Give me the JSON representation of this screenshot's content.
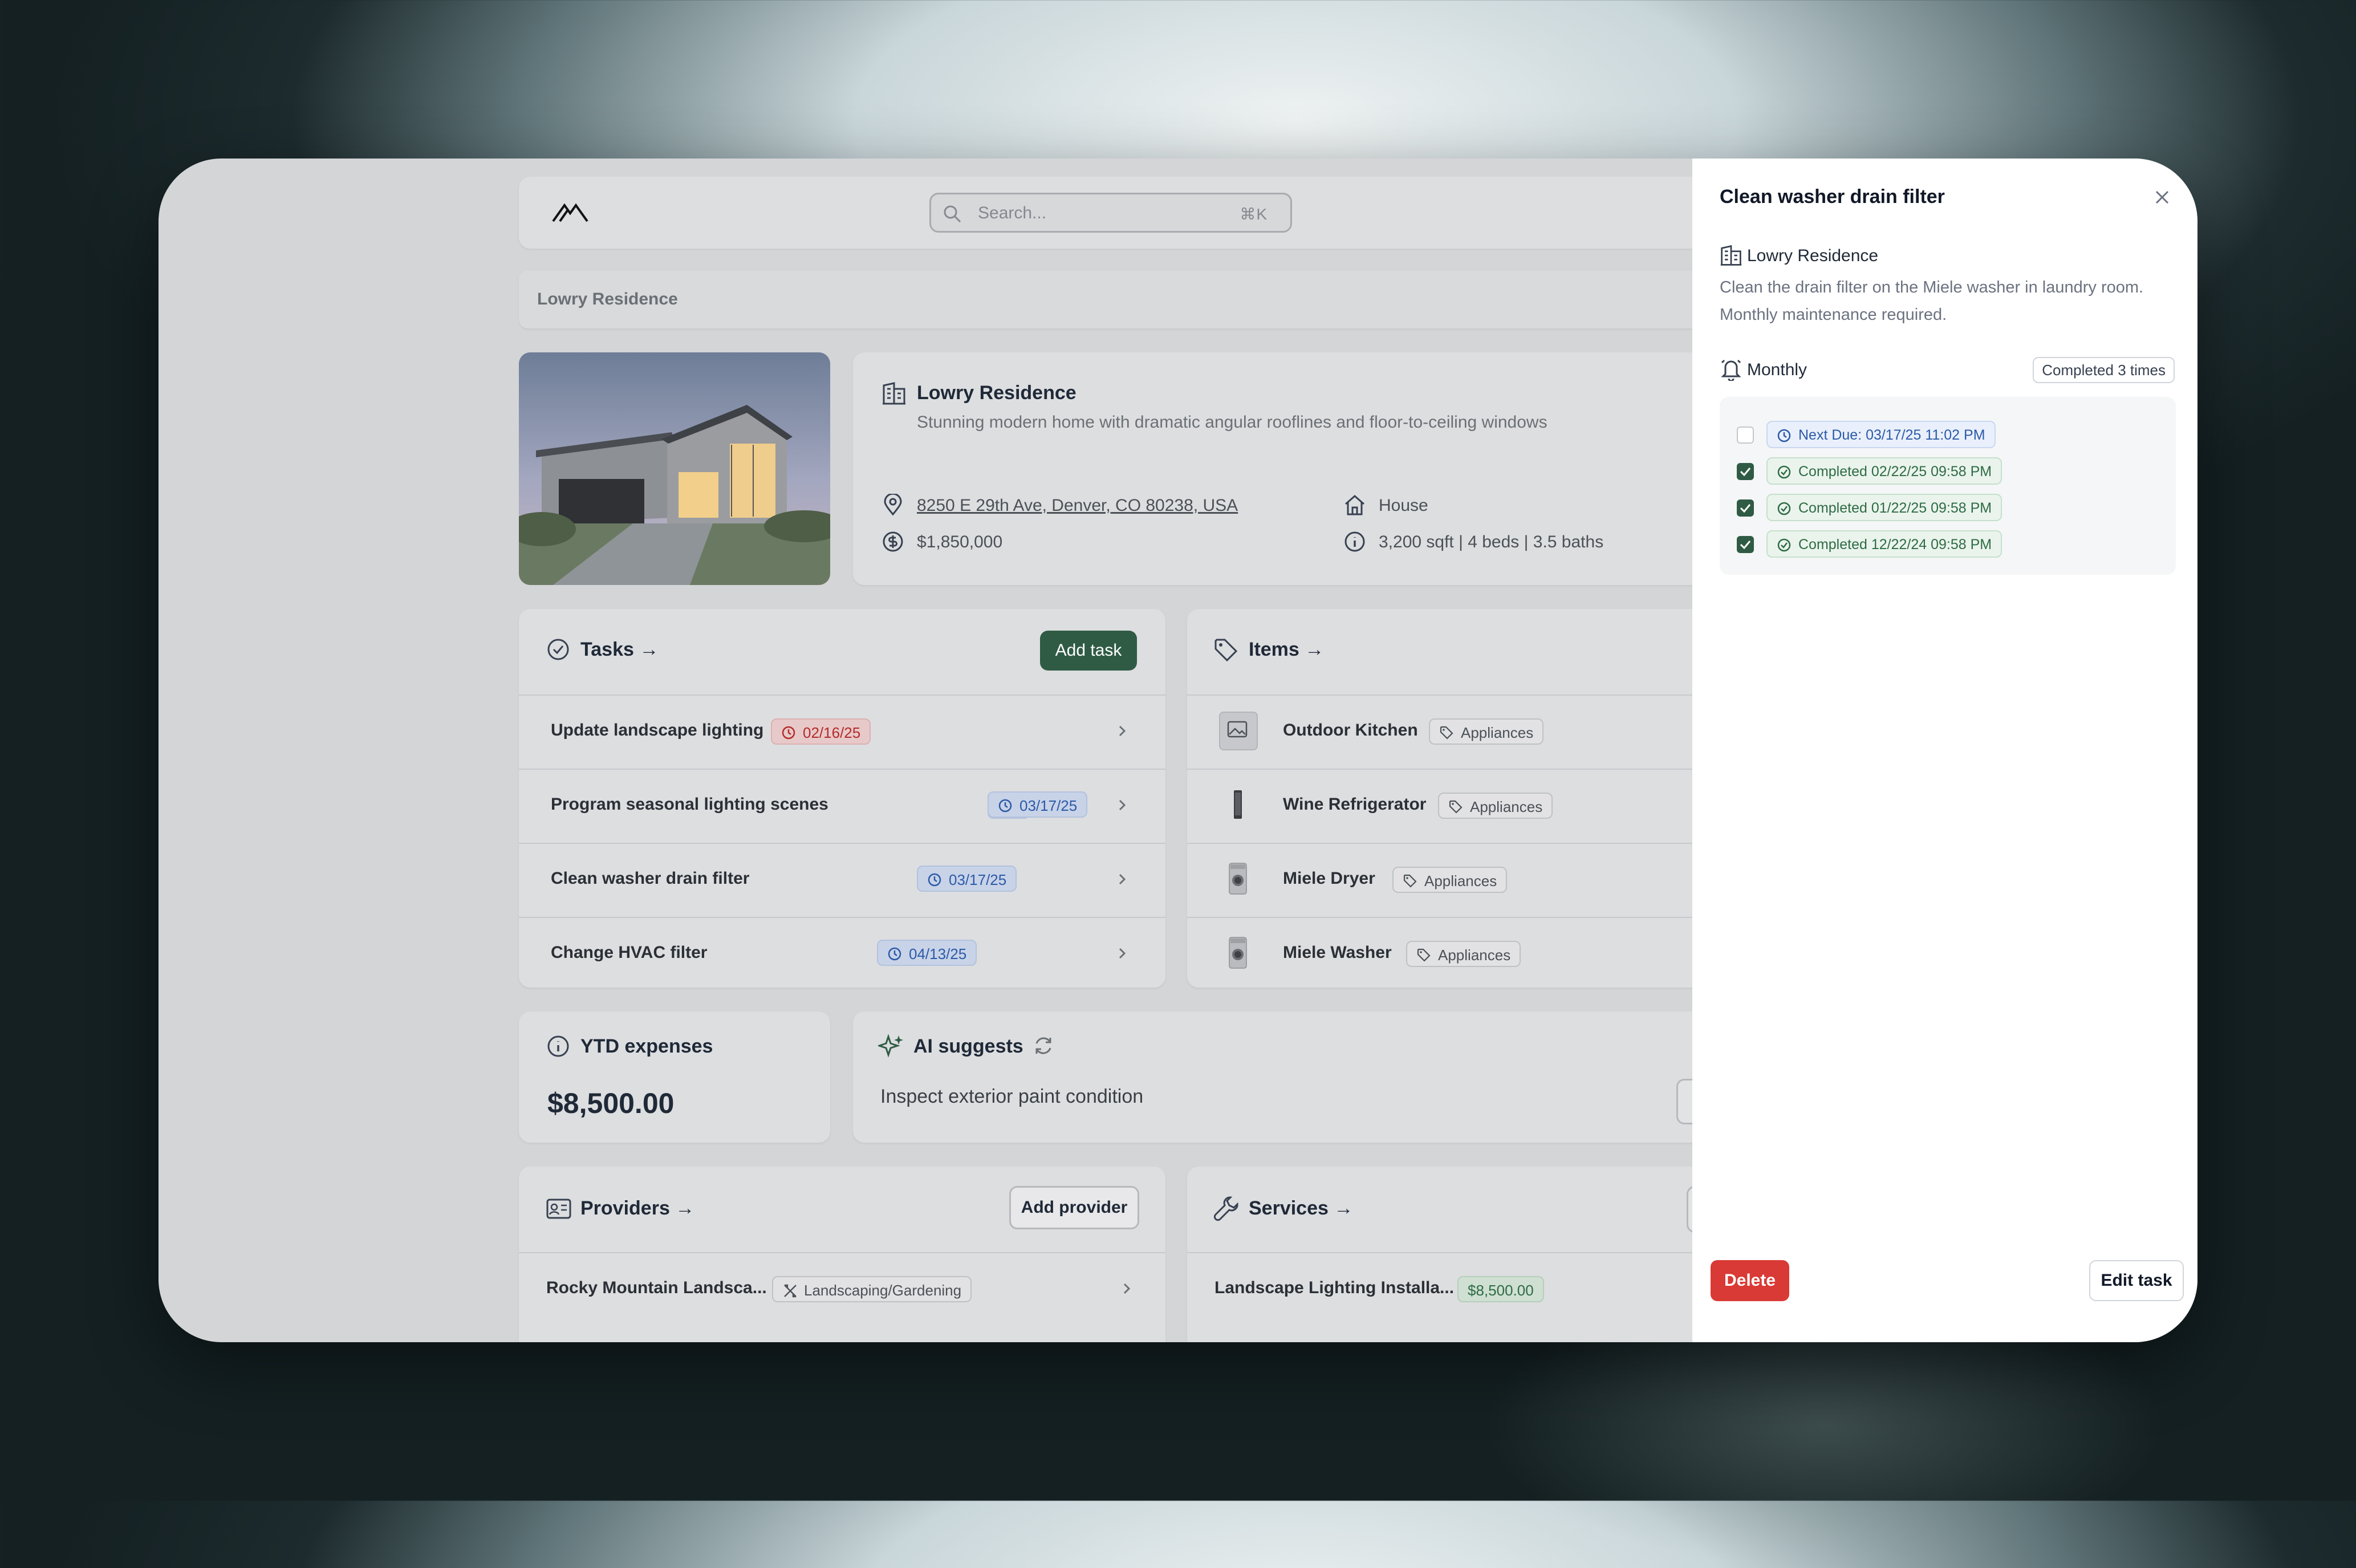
{
  "search": {
    "placeholder": "Search...",
    "shortcut": "⌘K"
  },
  "breadcrumb": {
    "current": "Lowry Residence"
  },
  "property": {
    "name": "Lowry Residence",
    "description": "Stunning modern home with dramatic angular rooflines and floor-to-ceiling windows",
    "address": "8250 E 29th Ave, Denver, CO 80238, USA",
    "price": "$1,850,000",
    "type": "House",
    "details": "3,200 sqft | 4 beds | 3.5 baths"
  },
  "tasks": {
    "title": "Tasks →",
    "add_label": "Add task",
    "rows": [
      {
        "name": "Update landscape lighting",
        "date": "02/16/25",
        "status": "overdue"
      },
      {
        "name": "Program seasonal lighting scenes",
        "date": "03/17/25",
        "status": "upcoming"
      },
      {
        "name": "Clean washer drain filter",
        "date": "03/17/25",
        "status": "upcoming"
      },
      {
        "name": "Change HVAC filter",
        "date": "04/13/25",
        "status": "upcoming"
      }
    ]
  },
  "items": {
    "title": "Items →",
    "rows": [
      {
        "name": "Outdoor Kitchen",
        "tag": "Appliances",
        "thumb": "image-placeholder-icon"
      },
      {
        "name": "Wine Refrigerator",
        "tag": "Appliances",
        "thumb": "wine-fridge"
      },
      {
        "name": "Miele Dryer",
        "tag": "Appliances",
        "thumb": "dryer"
      },
      {
        "name": "Miele Washer",
        "tag": "Appliances",
        "thumb": "washer"
      }
    ]
  },
  "ytd": {
    "title": "YTD expenses",
    "amount": "$8,500.00"
  },
  "ai": {
    "title": "AI suggests",
    "suggestion": "Inspect exterior paint condition"
  },
  "providers": {
    "title": "Providers →",
    "add_label": "Add provider",
    "rows": [
      {
        "name": "Rocky Mountain Landsca...",
        "tag": "Landscaping/Gardening"
      }
    ]
  },
  "services": {
    "title": "Services →",
    "rows": [
      {
        "name": "Landscape Lighting Installa...",
        "amount": "$8,500.00"
      }
    ]
  },
  "panel": {
    "title": "Clean washer drain filter",
    "location": "Lowry Residence",
    "description": "Clean the drain filter on the Miele washer in laundry room. Monthly maintenance required.",
    "frequency": "Monthly",
    "completed_count": "Completed 3 times",
    "history": [
      {
        "label": "Next Due: 03/17/25 11:02 PM",
        "checked": false
      },
      {
        "label": "Completed 02/22/25 09:58 PM",
        "checked": true
      },
      {
        "label": "Completed 01/22/25 09:58 PM",
        "checked": true
      },
      {
        "label": "Completed 12/22/24 09:58 PM",
        "checked": true
      }
    ],
    "delete_label": "Delete",
    "edit_label": "Edit task"
  },
  "colors": {
    "accent": "#2f5b44",
    "danger": "#d93a35",
    "overdue": "#b42b2b",
    "upcoming": "#2c5aa8"
  }
}
